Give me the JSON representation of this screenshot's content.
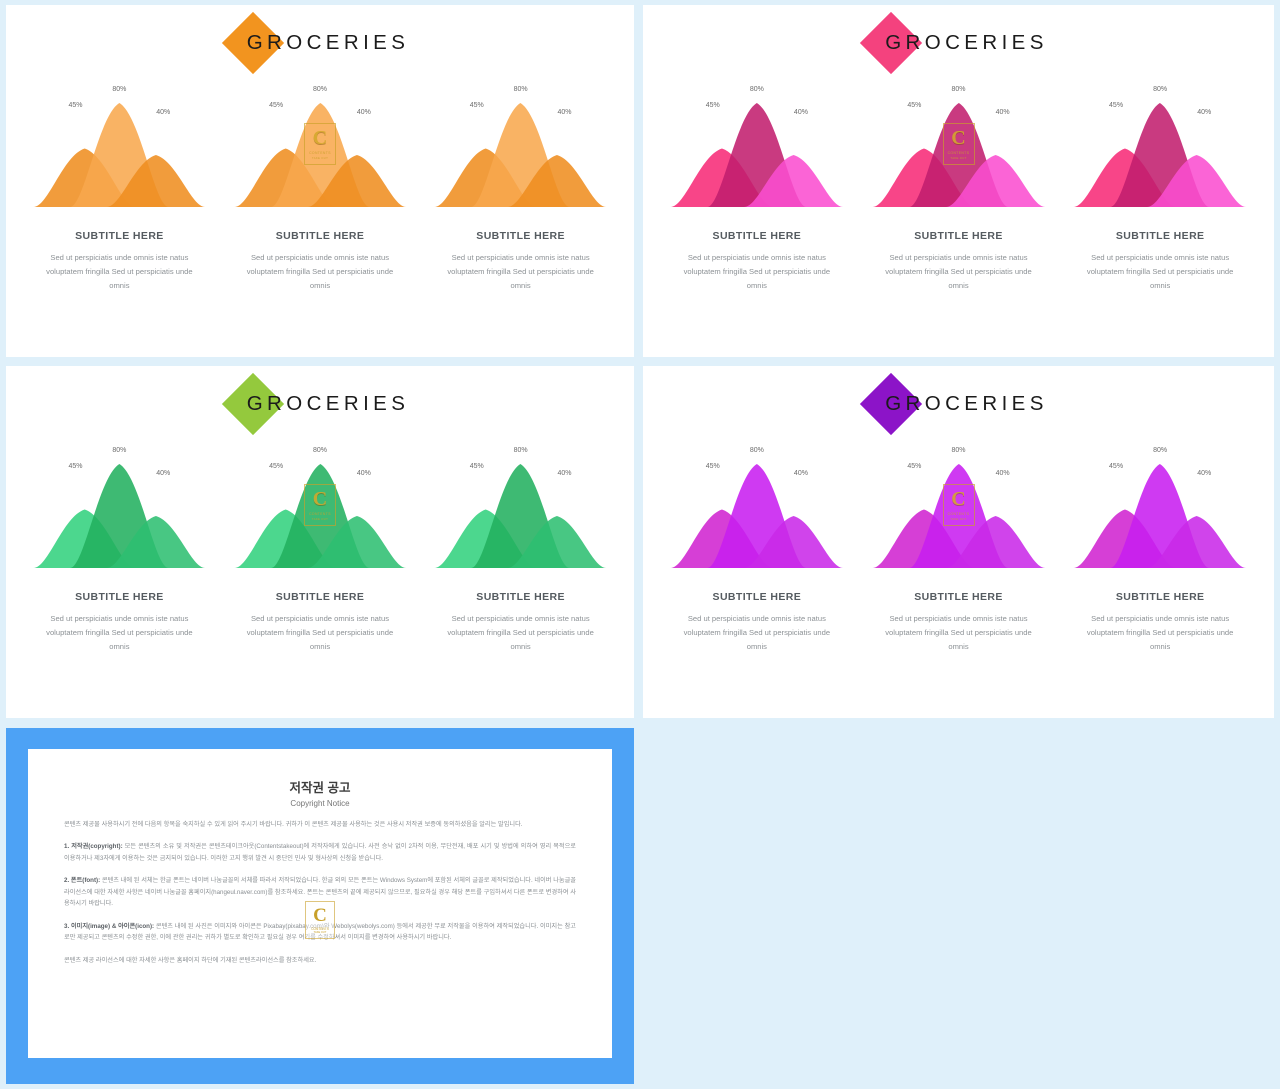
{
  "background_color": "#dff0fa",
  "brand": {
    "name": "GROCERIES",
    "logo_shape": "diamond"
  },
  "slides": [
    {
      "id": "orange",
      "theme": {
        "light": "#f5a council",
        "l": "#f6a council"
      },
      "logo_color": "#f2941f",
      "colors": {
        "peak_a": "#ef8e21",
        "peak_b": "#f8a94e",
        "peak_c": "#ef8e21",
        "overlap": "#e07c12"
      },
      "columns": [
        {
          "watermark": false,
          "peaks": [
            {
              "label": "45%",
              "value": 45
            },
            {
              "label": "80%",
              "value": 80
            },
            {
              "label": "40%",
              "value": 40
            }
          ],
          "subtitle": "SUBTITLE HERE",
          "body": "Sed ut perspiciatis unde omnis iste natus voluptatem fringilla Sed ut perspiciatis unde omnis"
        },
        {
          "watermark": true,
          "peaks": [
            {
              "label": "45%",
              "value": 45
            },
            {
              "label": "80%",
              "value": 80
            },
            {
              "label": "40%",
              "value": 40
            }
          ],
          "subtitle": "SUBTITLE HERE",
          "body": "Sed ut perspiciatis unde omnis iste natus voluptatem fringilla Sed ut perspiciatis unde omnis"
        },
        {
          "watermark": false,
          "peaks": [
            {
              "label": "45%",
              "value": 45
            },
            {
              "label": "80%",
              "value": 80
            },
            {
              "label": "40%",
              "value": 40
            }
          ],
          "subtitle": "SUBTITLE HERE",
          "body": "Sed ut perspiciatis unde omnis iste natus voluptatem fringilla Sed ut perspiciatis unde omnis"
        }
      ]
    },
    {
      "id": "pink",
      "logo_color": "#f4427e",
      "colors": {
        "peak_a": "#f72b78",
        "peak_b": "#c21f6e",
        "peak_c": "#fb4fd0",
        "overlap": "#b81a63"
      },
      "columns": [
        {
          "watermark": false,
          "peaks": [
            {
              "label": "45%",
              "value": 45
            },
            {
              "label": "80%",
              "value": 80
            },
            {
              "label": "40%",
              "value": 40
            }
          ],
          "subtitle": "SUBTITLE HERE",
          "body": "Sed ut perspiciatis unde omnis iste natus voluptatem fringilla Sed ut perspiciatis unde omnis"
        },
        {
          "watermark": true,
          "peaks": [
            {
              "label": "45%",
              "value": 45
            },
            {
              "label": "80%",
              "value": 80
            },
            {
              "label": "40%",
              "value": 40
            }
          ],
          "subtitle": "SUBTITLE HERE",
          "body": "Sed ut perspiciatis unde omnis iste natus voluptatem fringilla Sed ut perspiciatis unde omnis"
        },
        {
          "watermark": false,
          "peaks": [
            {
              "label": "45%",
              "value": 45
            },
            {
              "label": "80%",
              "value": 80
            },
            {
              "label": "40%",
              "value": 40
            }
          ],
          "subtitle": "SUBTITLE HERE",
          "body": "Sed ut perspiciatis unde omnis iste natus voluptatem fringilla Sed ut perspiciatis unde omnis"
        }
      ]
    },
    {
      "id": "green",
      "logo_color": "#94c93d",
      "colors": {
        "peak_a": "#33d27e",
        "peak_b": "#23b060",
        "peak_c": "#2fbf72",
        "overlap": "#1d9c53"
      },
      "columns": [
        {
          "watermark": false,
          "peaks": [
            {
              "label": "45%",
              "value": 45
            },
            {
              "label": "80%",
              "value": 80
            },
            {
              "label": "40%",
              "value": 40
            }
          ],
          "subtitle": "SUBTITLE HERE",
          "body": "Sed ut perspiciatis unde omnis iste natus voluptatem fringilla Sed ut perspiciatis unde omnis"
        },
        {
          "watermark": true,
          "peaks": [
            {
              "label": "45%",
              "value": 45
            },
            {
              "label": "80%",
              "value": 80
            },
            {
              "label": "40%",
              "value": 40
            }
          ],
          "subtitle": "SUBTITLE HERE",
          "body": "Sed ut perspiciatis unde omnis iste natus voluptatem fringilla Sed ut perspiciatis unde omnis"
        },
        {
          "watermark": false,
          "peaks": [
            {
              "label": "45%",
              "value": 45
            },
            {
              "label": "80%",
              "value": 80
            },
            {
              "label": "40%",
              "value": 40
            }
          ],
          "subtitle": "SUBTITLE HERE",
          "body": "Sed ut perspiciatis unde omnis iste natus voluptatem fringilla Sed ut perspiciatis unde omnis"
        }
      ]
    },
    {
      "id": "purple",
      "logo_color": "#8c14c8",
      "colors": {
        "peak_a": "#d024d0",
        "peak_b": "#c81ff0",
        "peak_c": "#c92ae8",
        "overlap": "#b312d8"
      },
      "columns": [
        {
          "watermark": false,
          "peaks": [
            {
              "label": "45%",
              "value": 45
            },
            {
              "label": "80%",
              "value": 80
            },
            {
              "label": "40%",
              "value": 40
            }
          ],
          "subtitle": "SUBTITLE HERE",
          "body": "Sed ut perspiciatis unde omnis iste natus voluptatem fringilla Sed ut perspiciatis unde omnis"
        },
        {
          "watermark": true,
          "peaks": [
            {
              "label": "45%",
              "value": 45
            },
            {
              "label": "80%",
              "value": 80
            },
            {
              "label": "40%",
              "value": 40
            }
          ],
          "subtitle": "SUBTITLE HERE",
          "body": "Sed ut perspiciatis unde omnis iste natus voluptatem fringilla Sed ut perspiciatis unde omnis"
        },
        {
          "watermark": false,
          "peaks": [
            {
              "label": "45%",
              "value": 45
            },
            {
              "label": "80%",
              "value": 80
            },
            {
              "label": "40%",
              "value": 40
            }
          ],
          "subtitle": "SUBTITLE HERE",
          "body": "Sed ut perspiciatis unde omnis iste natus voluptatem fringilla Sed ut perspiciatis unde omnis"
        }
      ]
    }
  ],
  "watermark": {
    "letter": "C",
    "line1": "CONTENTS",
    "line2": "TAKE OUT"
  },
  "copyright": {
    "frame_color": "#4da2f5",
    "title": "저작권 공고",
    "subtitle": "Copyright Notice",
    "intro": "콘텐츠 제공물 사용하시기 전에 다음의 항목을 숙지하실 수 있게 읽어 주시기 바랍니다. 귀하가 이 콘텐츠 제공물 사용하는 것은 사용시 저작권 보증에 동의하셨음을 알리는 말입니다.",
    "sections": [
      {
        "heading": "1. 저작권(copyright):",
        "text": "모든 콘텐츠의 소유 및 저작권은 콘텐츠테이크아웃(Contentstakeout)에 저작자에게 있습니다. 사전 승낙 없이 2차적 이용, 무단전재, 배포 시기 및 방법에 의하여 영리 목적으로 이용하거나 제3자에게 이용하는 것은 금지되어 있습니다. 이러한 고지 행위 발견 시 중단인 민사 및 형사상의 신청을 받습니다."
      },
      {
        "heading": "2. 폰트(font):",
        "text": "콘텐츠 내에 된 서체는 한글 폰트는 네이버 나눔글꼴의 서체를 따라서 저작되었습니다. 한글 외의 모든 폰트는 Windows System에 포함된 서체의 글꼴로 제작되었습니다. 네이버 나눔글꼴 라이선스에 대한 자세한 사항은 네이버 나눔글꼴 홈페이지(hangeul.naver.com)를 참조하세요. 폰트는 콘텐츠의 끝에 제공되지 않으므로, 필요하실 경우 해당 폰트를 구입하셔서 다른 폰트로 변경하여 사용하시기 바랍니다."
      },
      {
        "heading": "3. 이미지(image) & 아이콘(icon):",
        "text": "콘텐츠 내에 된 사진은 이미지와 아이콘은 Pixabay(pixabay.com)와 Webolys(webolys.com) 등에서 제공한 무료 저작물을 이용하여 제작되었습니다. 이미지는 참고로만 제공되고 콘텐츠의 수정한 권한, 이에 관한 권리는 귀하가 별도로 확인하고 필요실 경우 여기를 수정하셔서 이미지를 변경하여 사용하시기 바랍니다."
      }
    ],
    "footer": "콘텐츠 제공 라이선스에 대한 자세한 사항은 홈페이지 하단에 기재된 콘텐츠라이선스를 참조하세요."
  }
}
